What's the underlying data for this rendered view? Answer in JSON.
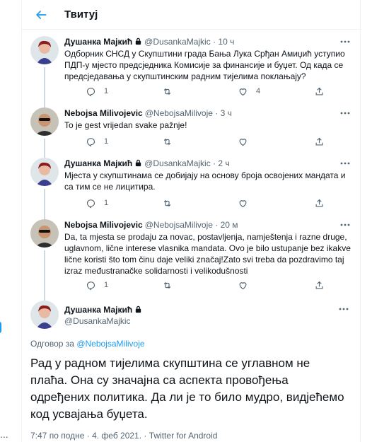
{
  "header": {
    "title": "Твитуј"
  },
  "colors": {
    "accent": "#1d9bf0",
    "muted": "#536471",
    "text": "#0f1419"
  },
  "tweets": [
    {
      "name": "Душанка Мајкић",
      "handle": "@DusankaMajkic",
      "time": "· 10 ч",
      "text": "Одборник СНСД у Скупштини града Бања Лука Срђан Амиџић уступио ПДП-у  мјесто предсједника Комисије за финансије и буџет. Од када се предсједавања у скупштинским радним тијелима поклањају?",
      "replies": "1",
      "retweets": "",
      "likes": "4"
    },
    {
      "name": "Nebojsa Milivojevic",
      "handle": "@NebojsaMilivoje",
      "time": "· 3 ч",
      "text": "To je gest vrijedan svake pažnje!",
      "replies": "1",
      "retweets": "",
      "likes": ""
    },
    {
      "name": "Душанка Мајкић",
      "handle": "@DusankaMajkic",
      "time": "· 2 ч",
      "text": "Мјеста у скупштинама се добијају на основу броја освојених мандата и са тим се не лицитира.",
      "replies": "1",
      "retweets": "",
      "likes": ""
    },
    {
      "name": "Nebojsa Milivojevic",
      "handle": "@NebojsaMilivoje",
      "time": "· 20 м",
      "text": "Da, ta mjesta se prodaju za novac, postavljenja, namještenja i razne druge, uglavnom, lične interese vlasnika mandata. Ovo je bilo ustupanje bez ikakve lične koristi što tom činu daje veliki značaj!Zato svi treba da pozdravimo taj izraz međustranačke solidarnosti i velikodušnosti",
      "replies": "1",
      "retweets": "",
      "likes": ""
    }
  ],
  "main_tweet": {
    "name": "Душанка Мајкић",
    "handle": "@DusankaMajkic",
    "reply_prefix": "Одговор за",
    "reply_to": "@NebojsaMilivoje",
    "text": "Рад у радном тијелима скупштина се углавном не плаћа. Она су значајна са аспекта провођења одређених политика. Да ли је то било мудро, видјећемо код усвајања буџета.",
    "meta": "7:47 по подне · 4. феб 2021. · Twitter for Android"
  },
  "edge_text": "..."
}
